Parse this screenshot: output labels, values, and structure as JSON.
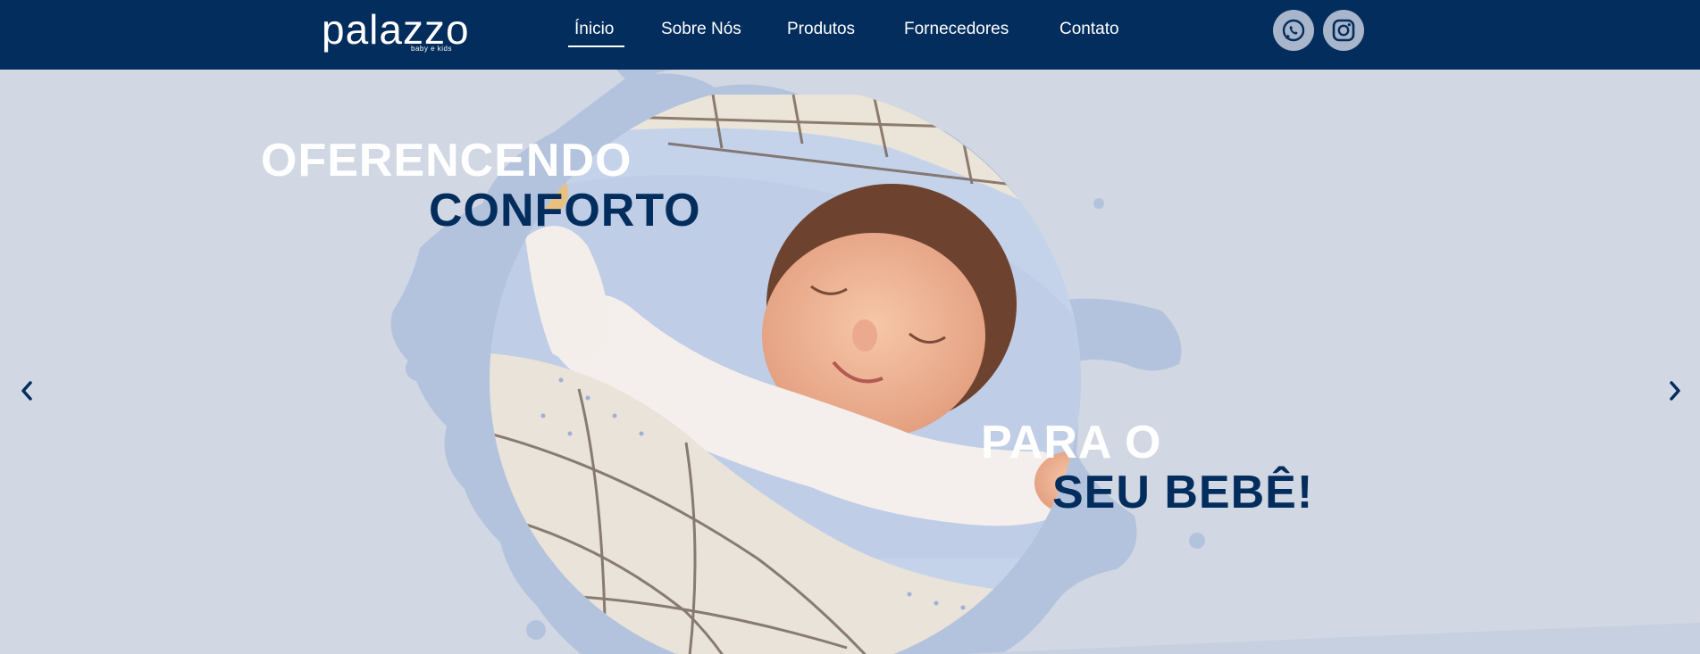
{
  "header": {
    "logo": {
      "name": "palazzo",
      "tagline": "baby e kids"
    },
    "nav": [
      {
        "label": "Ínicio",
        "active": true
      },
      {
        "label": "Sobre Nós",
        "active": false
      },
      {
        "label": "Produtos",
        "active": false
      },
      {
        "label": "Fornecedores",
        "active": false
      },
      {
        "label": "Contato",
        "active": false
      }
    ],
    "social": [
      {
        "icon": "whatsapp-icon"
      },
      {
        "icon": "instagram-icon"
      }
    ]
  },
  "hero": {
    "line1": "OFERENCENDO",
    "line2": "CONFORTO",
    "line3": "PARA O",
    "line4": "SEU BEBÊ!",
    "image": "sleeping-baby-photo"
  },
  "slider": {
    "prev_icon": "chevron-left-icon",
    "next_icon": "chevron-right-icon"
  },
  "colors": {
    "navy": "#022d5c",
    "background": "#d1d8e3",
    "splash": "#b4c3dd",
    "white": "#ffffff"
  }
}
